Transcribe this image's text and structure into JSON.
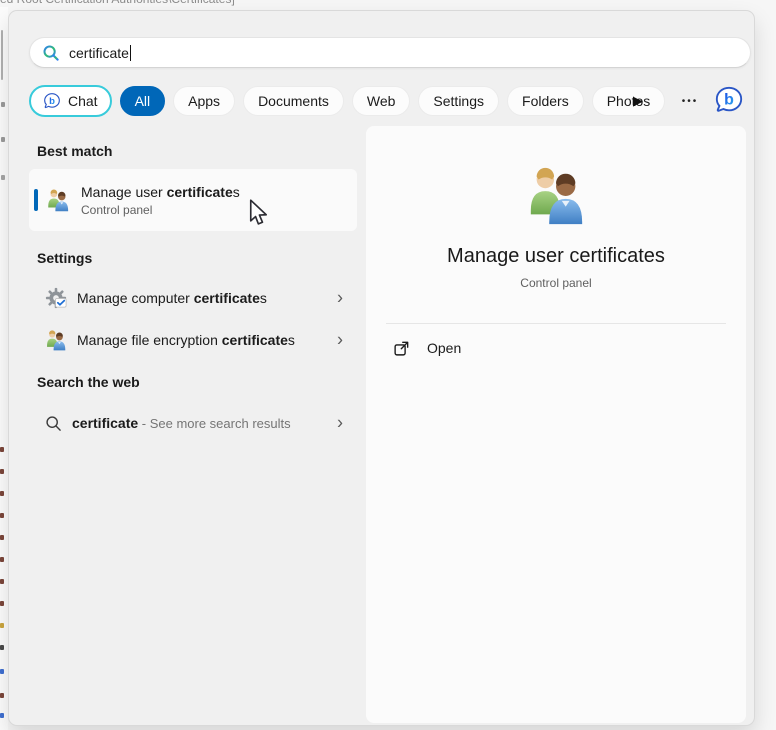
{
  "background_window": {
    "clipped_title_text": "ed Root Certification Authorities\\Certificates]"
  },
  "search_box": {
    "value": "certificate"
  },
  "filter_bar": {
    "chat_label": "Chat",
    "tabs": [
      "All",
      "Apps",
      "Documents",
      "Web",
      "Settings",
      "Folders",
      "Photos"
    ],
    "selected_tab": "All",
    "play_glyph": "▶",
    "more_glyph": "•••"
  },
  "left_panel": {
    "best_match": {
      "header": "Best match",
      "item": {
        "title_prefix": "Manage user ",
        "title_match": "certificate",
        "title_suffix": "s",
        "subtitle": "Control panel"
      }
    },
    "settings": {
      "header": "Settings",
      "items": [
        {
          "prefix": "Manage computer ",
          "match": "certificate",
          "suffix": "s"
        },
        {
          "prefix": "Manage file encryption ",
          "match": "certificate",
          "suffix": "s"
        }
      ]
    },
    "web_search": {
      "header": "Search the web",
      "item": {
        "query": "certificate",
        "rest": " - See more search results"
      }
    }
  },
  "right_panel": {
    "title": "Manage user certificates",
    "subtitle": "Control panel",
    "open_label": "Open"
  },
  "icons": {
    "chevron_glyph": "›"
  },
  "colors": {
    "accent": "#0067b8",
    "chat_border": "#38cbdb",
    "flyout_bg": "#f0f0f0",
    "panel_bg": "#fbfbfb",
    "best_match_highlight": "#fafafa"
  }
}
